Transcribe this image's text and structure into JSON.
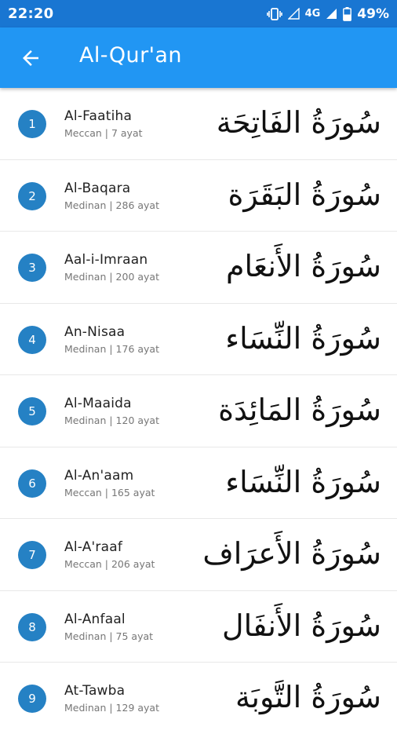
{
  "status_bar": {
    "time": "22:20",
    "network": "4G",
    "battery": "49%",
    "icons": [
      "vibrate-icon",
      "signal-empty-icon",
      "signal-icon",
      "battery-icon"
    ]
  },
  "app_bar": {
    "title": "Al-Qur'an",
    "back_icon": "arrow-back-icon"
  },
  "colors": {
    "status_bar": "#1976d2",
    "app_bar": "#2196f3",
    "number_badge": "#2581c4"
  },
  "surahs": [
    {
      "number": "1",
      "name": "Al-Faatiha",
      "meta": "Meccan | 7 ayat",
      "arabic": "سُورَةُ الفَاتِحَة"
    },
    {
      "number": "2",
      "name": "Al-Baqara",
      "meta": "Medinan | 286 ayat",
      "arabic": "سُورَةُ البَقَرَة"
    },
    {
      "number": "3",
      "name": "Aal-i-Imraan",
      "meta": "Medinan | 200 ayat",
      "arabic": "سُورَةُ الأَنعَام"
    },
    {
      "number": "4",
      "name": "An-Nisaa",
      "meta": "Medinan | 176 ayat",
      "arabic": "سُورَةُ النِّسَاء"
    },
    {
      "number": "5",
      "name": "Al-Maaida",
      "meta": "Medinan | 120 ayat",
      "arabic": "سُورَةُ المَائِدَة"
    },
    {
      "number": "6",
      "name": "Al-An'aam",
      "meta": "Meccan | 165 ayat",
      "arabic": "سُورَةُ النِّسَاء"
    },
    {
      "number": "7",
      "name": "Al-A'raaf",
      "meta": "Meccan | 206 ayat",
      "arabic": "سُورَةُ الأَعرَاف"
    },
    {
      "number": "8",
      "name": "Al-Anfaal",
      "meta": "Medinan | 75 ayat",
      "arabic": "سُورَةُ الأَنفَال"
    },
    {
      "number": "9",
      "name": "At-Tawba",
      "meta": "Medinan | 129 ayat",
      "arabic": "سُورَةُ التَّوبَة"
    }
  ]
}
